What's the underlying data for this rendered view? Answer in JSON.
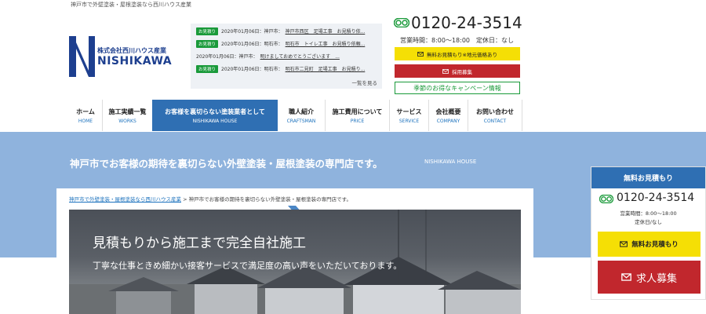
{
  "colors": {
    "brand": "#1d3f8f",
    "accent_blue": "#2f6fb3",
    "green": "#1a9a3a",
    "yellow": "#f5df05",
    "red": "#c1272d",
    "band": "#8fb3dd"
  },
  "topbar": {
    "text": "神戸市で外壁塗装・屋根塗装なら西川ハウス産業"
  },
  "logo": {
    "company_jp": "株式会社西川ハウス産業",
    "company_en": "NISHIKAWA",
    "icon": "nishikawa-logo-icon"
  },
  "news": {
    "items": [
      {
        "tag": "お見積り",
        "date": "2020年01月06日：神戸市：",
        "title": "神戸市西区　足場工事　お見積り依..."
      },
      {
        "tag": "お見積り",
        "date": "2020年01月06日：明石市：",
        "title": "明石市　トイレ工事　お見積り依頼..."
      },
      {
        "tag": "",
        "date": "2020年01月06日：神戸市：",
        "title": "明けましておめでとうございます　..."
      },
      {
        "tag": "お見積り",
        "date": "2020年01月06日：明石市：",
        "title": "明石市二見町　足場工事　お見積り..."
      }
    ],
    "more": "一覧を見る"
  },
  "contact": {
    "phone": "0120-24-3514",
    "hours": "営業時間：8:00～18:00　定休日：なし",
    "estimate_button": "無料お見積もり※地元価格あり",
    "recruit_button": "採用募集",
    "campaign_button": "季節のお得なキャンペーン情報"
  },
  "nav": [
    {
      "ja": "ホーム",
      "en": "HOME"
    },
    {
      "ja": "施工実績一覧",
      "en": "WORKS"
    },
    {
      "ja": "お客様を裏切らない塗装業者として",
      "en": "NISHIKAWA HOUSE"
    },
    {
      "ja": "職人紹介",
      "en": "CRAFTSMAN"
    },
    {
      "ja": "施工費用について",
      "en": "PRICE"
    },
    {
      "ja": "サービス",
      "en": "SERVICE"
    },
    {
      "ja": "会社概要",
      "en": "COMPANY"
    },
    {
      "ja": "お問い合わせ",
      "en": "CONTACT"
    }
  ],
  "band": {
    "title": "神戸市でお客様の期待を裏切らない外壁塗装・屋根塗装の専門店です。",
    "subtitle": "NISHIKAWA HOUSE"
  },
  "breadcrumb": {
    "home": "神戸市で外壁塗装・屋根塗装なら西川ハウス産業",
    "separator": " > ",
    "current": "神戸市でお客様の期待を裏切らない外壁塗装・屋根塗装の専門店です。"
  },
  "hero": {
    "title": "見積もりから施工まで完全自社施工",
    "subtitle": "丁寧な仕事ときめ細かい接客サービスで満足度の高い声をいただいております。"
  },
  "sidebar": {
    "heading": "無料お見積もり",
    "phone": "0120-24-3514",
    "hours": "営業時間：8:00～18:00",
    "holiday": "定休日/なし",
    "estimate_button": "無料お見積もり",
    "recruit_button": "求人募集"
  }
}
